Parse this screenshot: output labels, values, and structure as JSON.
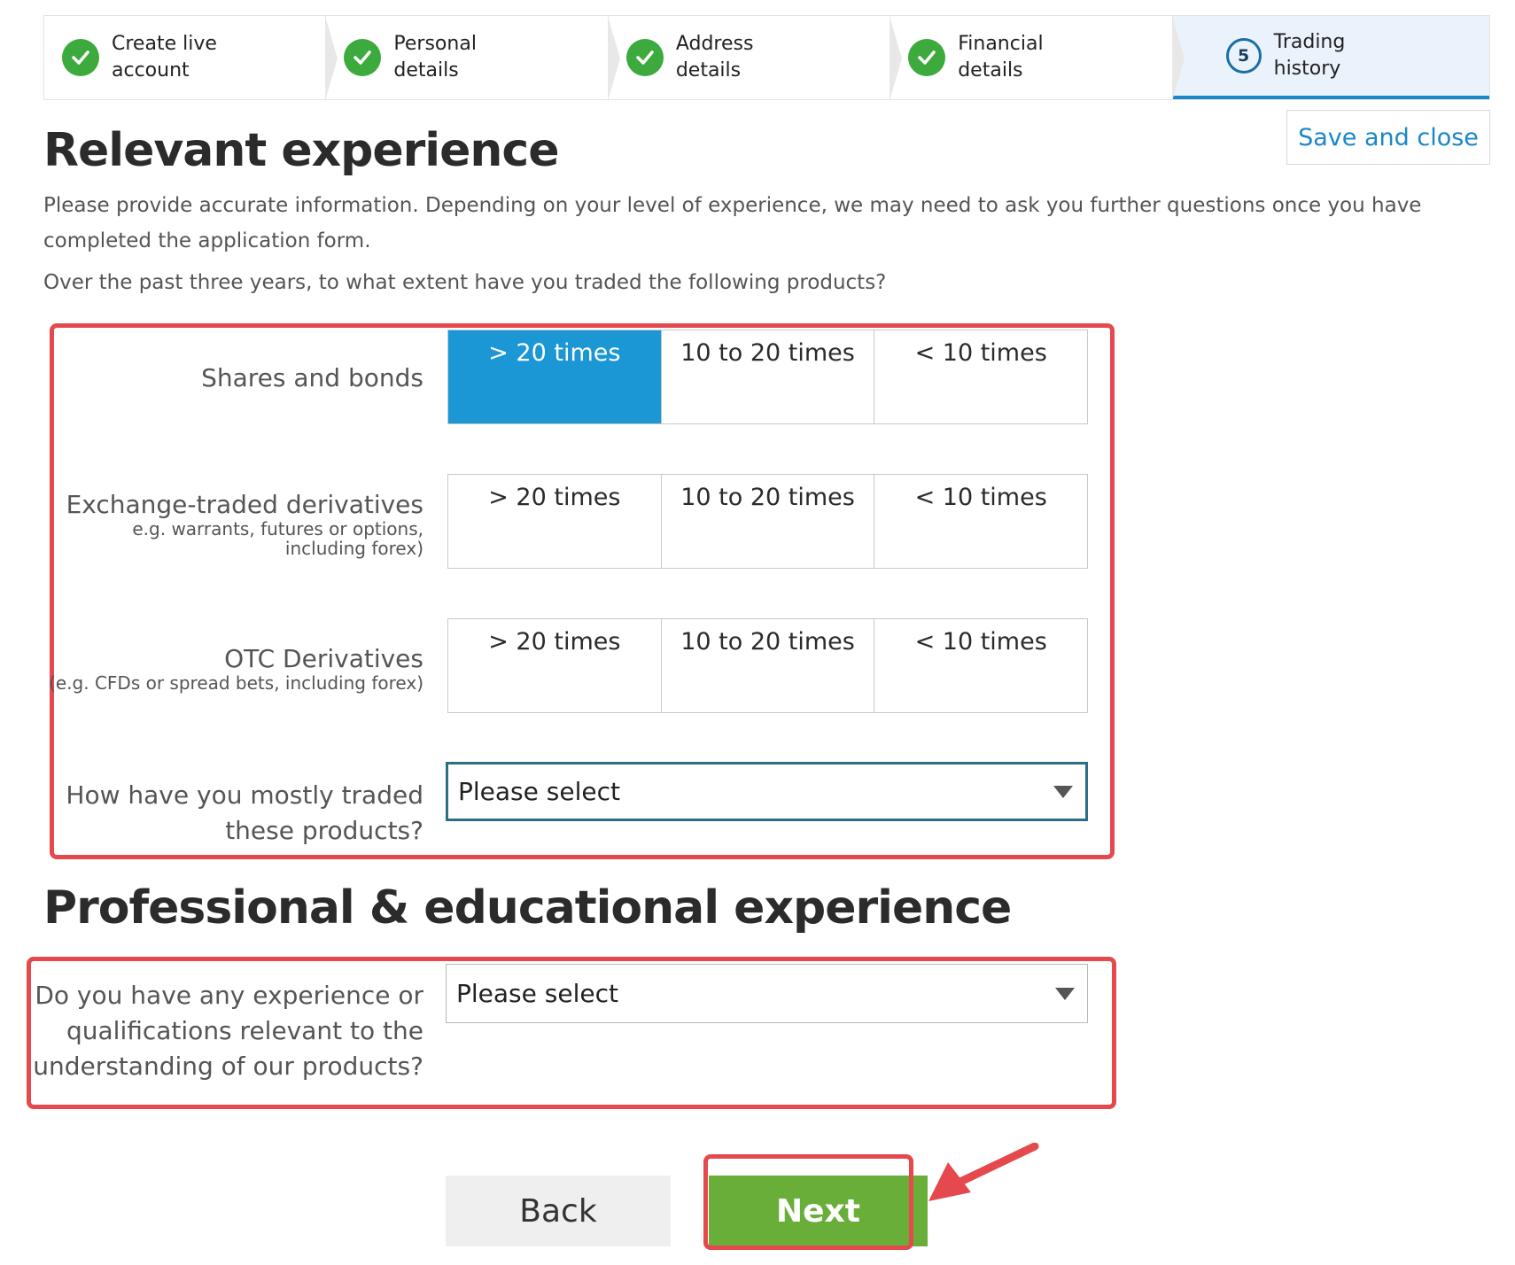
{
  "stepper": {
    "steps": [
      {
        "label": "Create live\naccount",
        "state": "done",
        "icon": "check-icon"
      },
      {
        "label": "Personal\ndetails",
        "state": "done",
        "icon": "check-icon"
      },
      {
        "label": "Address\ndetails",
        "state": "done",
        "icon": "check-icon"
      },
      {
        "label": "Financial\ndetails",
        "state": "done",
        "icon": "check-icon"
      },
      {
        "label": "Trading\nhistory",
        "state": "active",
        "number": "5"
      }
    ]
  },
  "header": {
    "save_close": "Save and close"
  },
  "relevant": {
    "title": "Relevant experience",
    "intro": "Please provide accurate information. Depending on your level of experience, we may need to ask you further questions once you have completed the application form.",
    "question": "Over the past three years, to what extent have you traded the following products?",
    "options": [
      "> 20 times",
      "10 to 20 times",
      "< 10 times"
    ],
    "products": [
      {
        "label": "Shares and bonds",
        "sub": "",
        "selected": "> 20 times"
      },
      {
        "label": "Exchange-traded derivatives",
        "sub": "e.g. warrants, futures or options, including forex)",
        "selected": null
      },
      {
        "label": "OTC Derivatives",
        "sub": "(e.g. CFDs or spread bets, including forex)",
        "selected": null
      }
    ],
    "mostly_label_1": "How have you mostly traded",
    "mostly_label_2": "these products?",
    "mostly_value": "Please select"
  },
  "professional": {
    "title": "Professional & educational experience",
    "label_1": "Do you have any experience or",
    "label_2": "qualifications relevant to the",
    "label_3": "understanding of our products?",
    "value": "Please select"
  },
  "buttons": {
    "back": "Back",
    "next": "Next"
  },
  "colors": {
    "accent": "#1a97d4",
    "success": "#3caa3c",
    "next": "#6aae3a",
    "highlight": "#e5494e"
  }
}
